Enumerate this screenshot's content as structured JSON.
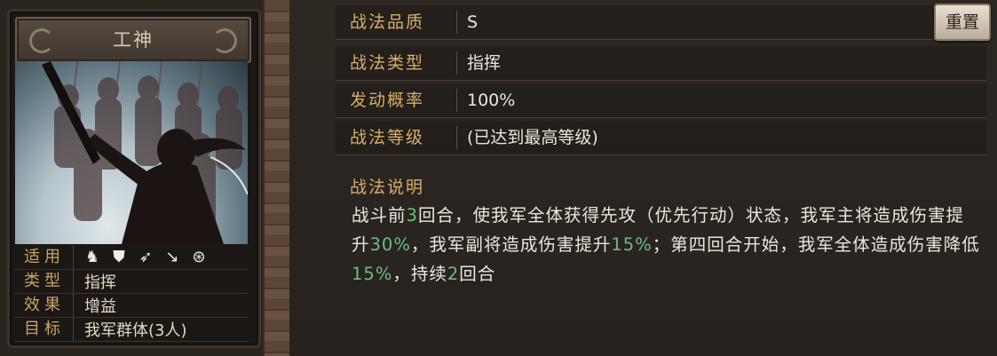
{
  "card": {
    "title": "工神",
    "stats": [
      {
        "key": "适用",
        "troop_icons": [
          "horse-icon",
          "shield-icon",
          "bow-icon",
          "spear-icon",
          "wheel-icon"
        ]
      },
      {
        "key": "类型",
        "value": "指挥"
      },
      {
        "key": "效果",
        "value": "增益"
      },
      {
        "key": "目标",
        "value": "我军群体(3人)"
      }
    ]
  },
  "info": {
    "rows": [
      {
        "key": "战法品质",
        "value": "S"
      },
      {
        "key": "战法类型",
        "value": "指挥"
      },
      {
        "key": "发动概率",
        "value": "100%"
      },
      {
        "key": "战法等级",
        "value": "(已达到最高等级)"
      }
    ],
    "reset_label": "重置",
    "desc_key": "战法说明",
    "desc_parts": [
      {
        "text": "战斗前",
        "hl": false
      },
      {
        "text": "3",
        "hl": true
      },
      {
        "text": "回合，使我军全体获得先攻（优先行动）状态，我军主将造成伤害提升",
        "hl": false
      },
      {
        "text": "30%",
        "hl": true
      },
      {
        "text": "，我军副将造成伤害提升",
        "hl": false
      },
      {
        "text": "15%",
        "hl": true
      },
      {
        "text": "；第四回合开始，我军全体造成伤害降低",
        "hl": false
      },
      {
        "text": "15%",
        "hl": true
      },
      {
        "text": "，持续",
        "hl": false
      },
      {
        "text": "2",
        "hl": true
      },
      {
        "text": "回合",
        "hl": false
      }
    ]
  },
  "colors": {
    "label_gold": "#d6ae6b",
    "highlight_green": "#66c07a",
    "text_light": "#ece6dc"
  }
}
